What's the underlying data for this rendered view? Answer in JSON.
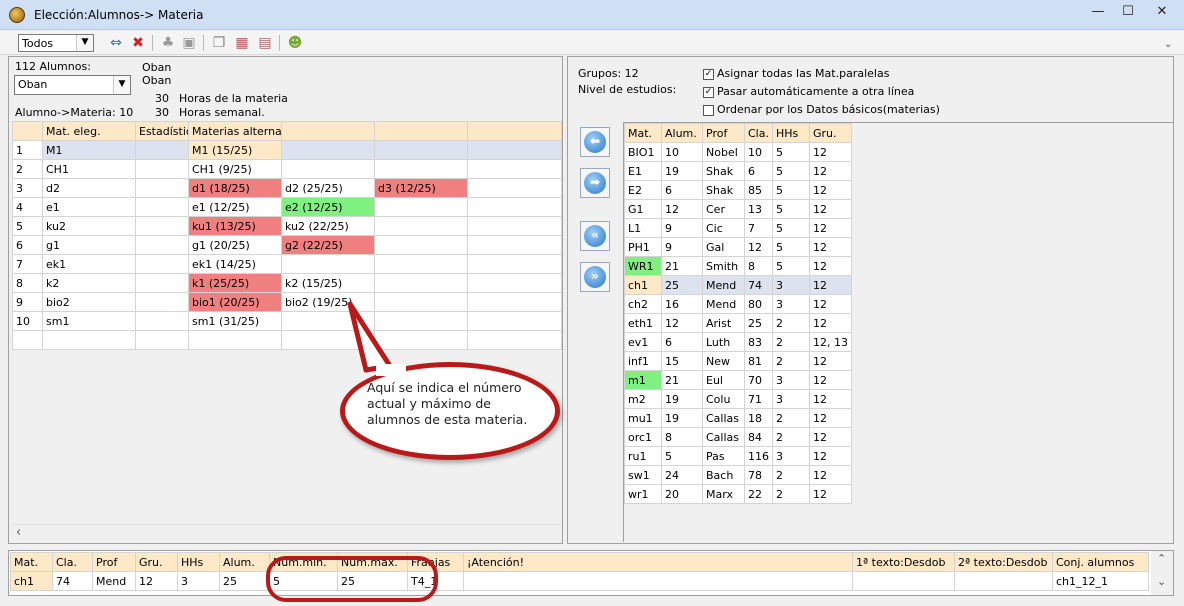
{
  "window": {
    "title": "Elección:Alumnos-> Materia",
    "min": "—",
    "max": "☐",
    "close": "✕"
  },
  "toolbar": {
    "filter_value": "Todos",
    "filter_arrow": "▼"
  },
  "left": {
    "student_count": "112 Alumnos:",
    "teacher_a": "Oban",
    "teacher_b": "Oban",
    "student_select": "Oban",
    "hours_value": "30",
    "hours_label": "Horas de la materia",
    "weekly_value": "30",
    "weekly_label": "Horas semanal.",
    "alumno_materia": "Alumno->Materia: 10",
    "headers": [
      "",
      "Mat. eleg.",
      "Estadístic",
      "Materias alternat.",
      "",
      "",
      ""
    ],
    "rows": [
      {
        "n": "1",
        "mat": "M1",
        "alts": [
          {
            "t": "M1 (15/25)",
            "c": ""
          },
          {
            "t": "",
            "c": ""
          },
          {
            "t": "",
            "c": ""
          },
          {
            "t": "",
            "c": ""
          }
        ]
      },
      {
        "n": "2",
        "mat": "CH1",
        "alts": [
          {
            "t": "CH1 (9/25)",
            "c": ""
          },
          {
            "t": "",
            "c": ""
          },
          {
            "t": "",
            "c": ""
          },
          {
            "t": "",
            "c": ""
          }
        ]
      },
      {
        "n": "3",
        "mat": "d2",
        "alts": [
          {
            "t": "d1 (18/25)",
            "c": "red"
          },
          {
            "t": "d2 (25/25)",
            "c": ""
          },
          {
            "t": "d3 (12/25)",
            "c": "red"
          },
          {
            "t": "",
            "c": ""
          }
        ]
      },
      {
        "n": "4",
        "mat": "e1",
        "alts": [
          {
            "t": "e1 (12/25)",
            "c": ""
          },
          {
            "t": "e2 (12/25)",
            "c": "green"
          },
          {
            "t": "",
            "c": ""
          },
          {
            "t": "",
            "c": ""
          }
        ]
      },
      {
        "n": "5",
        "mat": "ku2",
        "alts": [
          {
            "t": "ku1 (13/25)",
            "c": "red"
          },
          {
            "t": "ku2 (22/25)",
            "c": ""
          },
          {
            "t": "",
            "c": ""
          },
          {
            "t": "",
            "c": ""
          }
        ]
      },
      {
        "n": "6",
        "mat": "g1",
        "alts": [
          {
            "t": "g1 (20/25)",
            "c": ""
          },
          {
            "t": "g2 (22/25)",
            "c": "red"
          },
          {
            "t": "",
            "c": ""
          },
          {
            "t": "",
            "c": ""
          }
        ]
      },
      {
        "n": "7",
        "mat": "ek1",
        "alts": [
          {
            "t": "ek1 (14/25)",
            "c": ""
          },
          {
            "t": "",
            "c": ""
          },
          {
            "t": "",
            "c": ""
          },
          {
            "t": "",
            "c": ""
          }
        ]
      },
      {
        "n": "8",
        "mat": "k2",
        "alts": [
          {
            "t": "k1 (25/25)",
            "c": "red"
          },
          {
            "t": "k2 (15/25)",
            "c": ""
          },
          {
            "t": "",
            "c": ""
          },
          {
            "t": "",
            "c": ""
          }
        ]
      },
      {
        "n": "9",
        "mat": "bio2",
        "alts": [
          {
            "t": "bio1 (20/25)",
            "c": "red"
          },
          {
            "t": "bio2 (19/25)",
            "c": ""
          },
          {
            "t": "",
            "c": ""
          },
          {
            "t": "",
            "c": ""
          }
        ]
      },
      {
        "n": "10",
        "mat": "sm1",
        "alts": [
          {
            "t": "sm1 (31/25)",
            "c": ""
          },
          {
            "t": "",
            "c": ""
          },
          {
            "t": "",
            "c": ""
          },
          {
            "t": "",
            "c": ""
          }
        ]
      },
      {
        "n": "",
        "mat": "",
        "alts": [
          {
            "t": "",
            "c": ""
          },
          {
            "t": "",
            "c": ""
          },
          {
            "t": "",
            "c": ""
          },
          {
            "t": "",
            "c": ""
          }
        ]
      }
    ]
  },
  "right": {
    "grupos": "Grupos: 12",
    "nivel": "Nivel de estudios:",
    "opt1": "Asignar todas las Mat.paralelas",
    "opt2": "Pasar automáticamente a otra línea",
    "opt3": "Ordenar por los Datos básicos(materias)",
    "headers": [
      "Mat.",
      "Alum.",
      "Prof",
      "Cla.",
      "HHs",
      "Gru."
    ],
    "rows": [
      [
        "BIO1",
        "10",
        "Nobel",
        "10",
        "5",
        "12",
        ""
      ],
      [
        "E1",
        "19",
        "Shak",
        "6",
        "5",
        "12",
        ""
      ],
      [
        "E2",
        "6",
        "Shak",
        "85",
        "5",
        "12",
        ""
      ],
      [
        "G1",
        "12",
        "Cer",
        "13",
        "5",
        "12",
        ""
      ],
      [
        "L1",
        "9",
        "Cic",
        "7",
        "5",
        "12",
        ""
      ],
      [
        "PH1",
        "9",
        "Gal",
        "12",
        "5",
        "12",
        ""
      ],
      [
        "WR1",
        "21",
        "Smith",
        "8",
        "5",
        "12",
        "green"
      ],
      [
        "ch1",
        "25",
        "Mend",
        "74",
        "3",
        "12",
        "sel"
      ],
      [
        "ch2",
        "16",
        "Mend",
        "80",
        "3",
        "12",
        ""
      ],
      [
        "eth1",
        "12",
        "Arist",
        "25",
        "2",
        "12",
        ""
      ],
      [
        "ev1",
        "6",
        "Luth",
        "83",
        "2",
        "12, 13",
        ""
      ],
      [
        "inf1",
        "15",
        "New",
        "81",
        "2",
        "12",
        ""
      ],
      [
        "m1",
        "21",
        "Eul",
        "70",
        "3",
        "12",
        "green"
      ],
      [
        "m2",
        "19",
        "Colu",
        "71",
        "3",
        "12",
        ""
      ],
      [
        "mu1",
        "19",
        "Callas",
        "18",
        "2",
        "12",
        ""
      ],
      [
        "orc1",
        "8",
        "Callas",
        "84",
        "2",
        "12",
        ""
      ],
      [
        "ru1",
        "5",
        "Pas",
        "116",
        "3",
        "12",
        ""
      ],
      [
        "sw1",
        "24",
        "Bach",
        "78",
        "2",
        "12",
        ""
      ],
      [
        "wr1",
        "20",
        "Marx",
        "22",
        "2",
        "12",
        ""
      ]
    ]
  },
  "bottom": {
    "headers": [
      "Mat.",
      "Cla.",
      "Prof",
      "Gru.",
      "HHs",
      "Alum.",
      "Num.min.",
      "Num.max.",
      "Franjas",
      "¡Atención!",
      "1ª texto:Desdob",
      "2ª texto:Desdob",
      "Conj. alumnos"
    ],
    "values": [
      "ch1",
      "74",
      "Mend",
      "12",
      "3",
      "25",
      "5",
      "25",
      "T4_1",
      "",
      "",
      "",
      "ch1_12_1"
    ]
  },
  "callout": {
    "text": "Aquí se indica el número actual y máximo de alumnos de esta materia."
  },
  "icons": {
    "swap": "⇔",
    "delete": "✖",
    "check": "✓",
    "arrow_left": "⬅",
    "arrow_right": "➡",
    "dbl_left": "«",
    "dbl_right": "»",
    "scroll_left": "‹",
    "scroll_up": "⌃",
    "scroll_down": "⌄",
    "chevron": "⌄"
  },
  "colors": {
    "header": "#fde9c8",
    "red": "#f08080",
    "green": "#80f080",
    "selected": "#dde3ee",
    "callout_border": "#b81a1a"
  }
}
